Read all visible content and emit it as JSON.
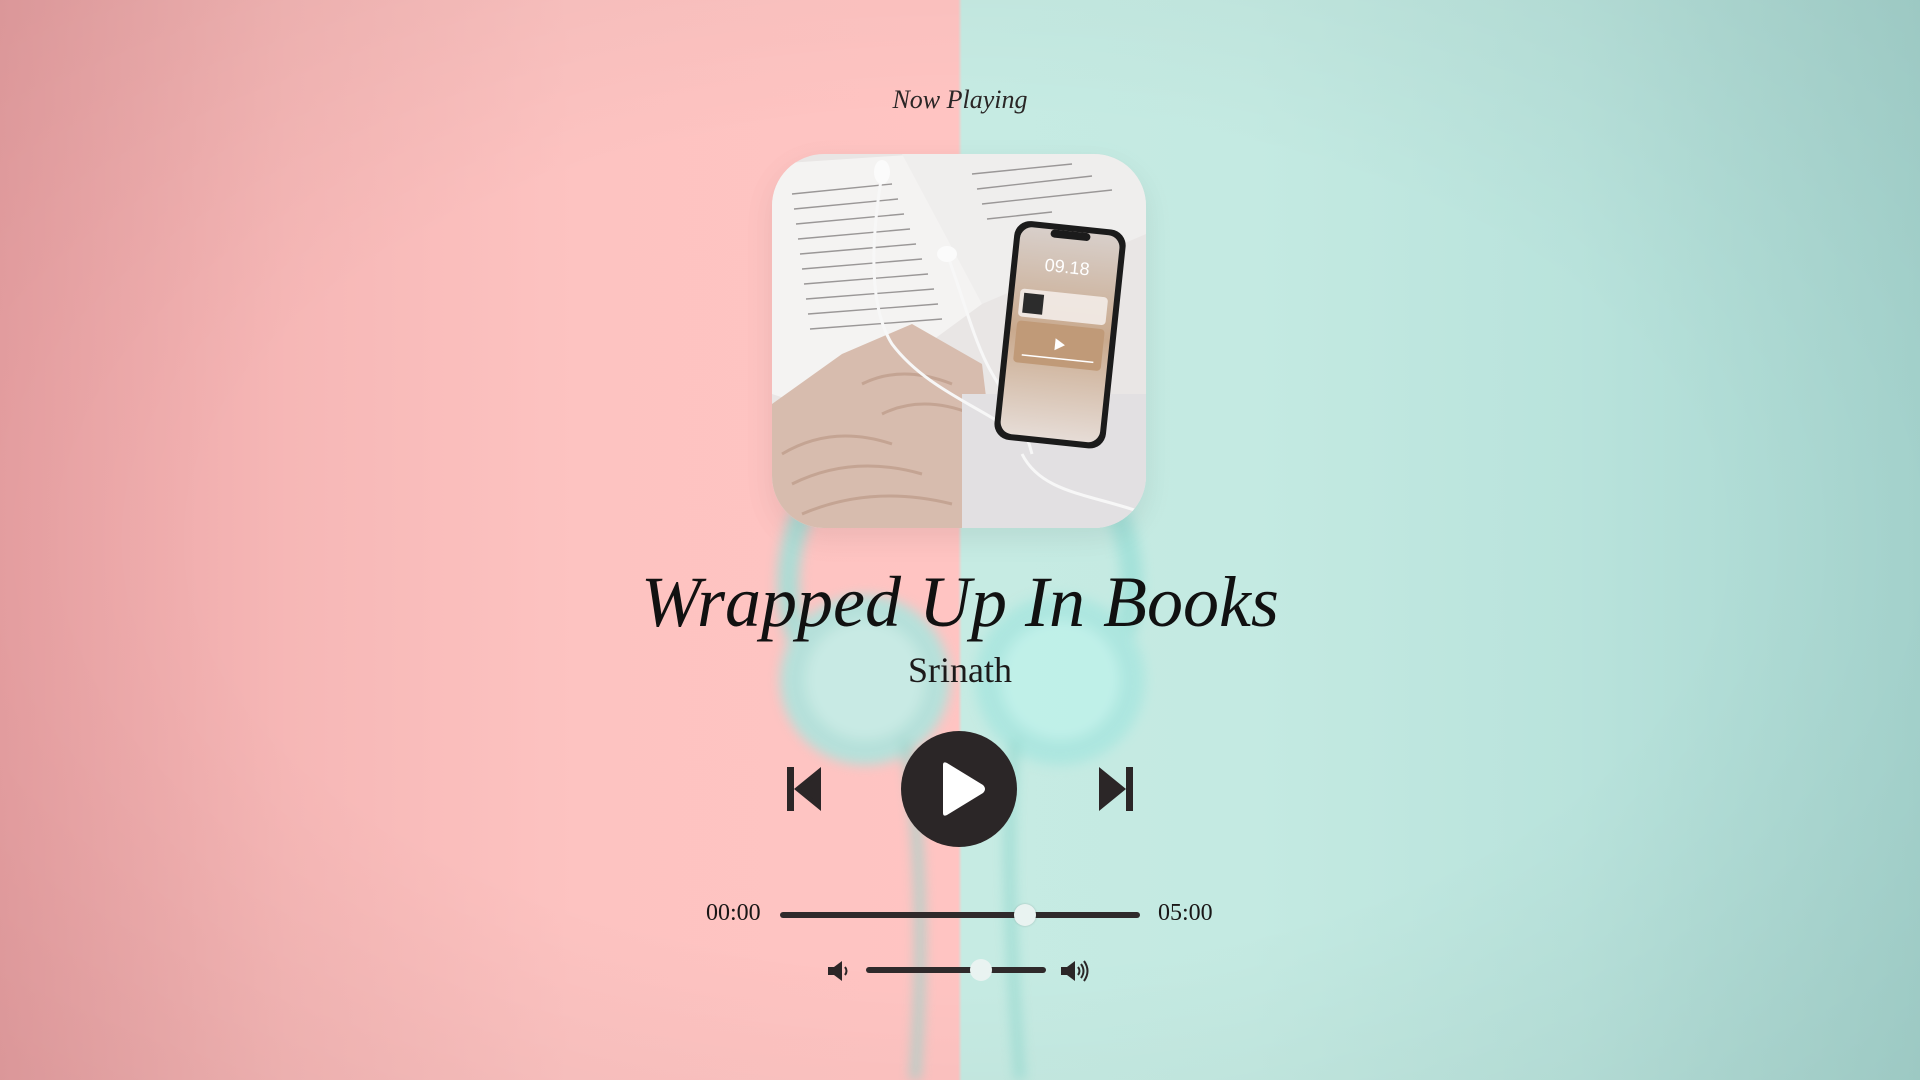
{
  "header": {
    "label": "Now Playing"
  },
  "track": {
    "title": "Wrapped Up In Books",
    "artist": "Srinath",
    "cover_icon": "album-art-phone-book-earbuds"
  },
  "controls": {
    "prev_icon": "skip-previous-icon",
    "play_icon": "play-icon",
    "next_icon": "skip-next-icon"
  },
  "progress": {
    "current_time": "00:00",
    "total_time": "05:00",
    "position_fraction": 0.68
  },
  "volume": {
    "level_fraction": 0.64,
    "down_icon": "volume-low-icon",
    "up_icon": "volume-high-icon"
  },
  "colors": {
    "bg_left": "#ffc4c2",
    "bg_right": "#c4eae2",
    "control_dark": "#2b2627",
    "thumb": "#e9f3f1"
  }
}
